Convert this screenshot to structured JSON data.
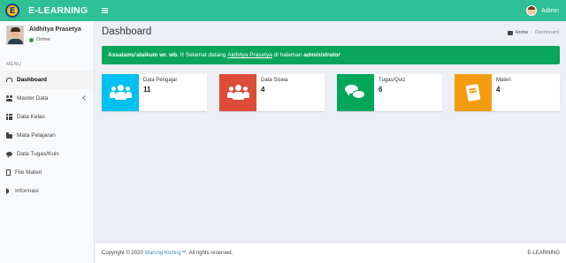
{
  "header": {
    "logo_letter": "E",
    "app_name": "E-LEARNING",
    "user_name": "Admin",
    "accent_color": "#2fc096"
  },
  "sidebar": {
    "user": {
      "name": "Aldhitya Prasetya",
      "status": "Online"
    },
    "menu_header": "MENU",
    "items": [
      {
        "label": "Dashboard",
        "icon": "dashboard-icon",
        "active": true
      },
      {
        "label": "Master Data",
        "icon": "users-icon",
        "has_submenu": true
      },
      {
        "label": "Data Kelas",
        "icon": "grid-icon"
      },
      {
        "label": "Mata Pelajaran",
        "icon": "folder-icon"
      },
      {
        "label": "Data Tugas/Kuis",
        "icon": "comments-icon"
      },
      {
        "label": "File Materi",
        "icon": "file-icon"
      },
      {
        "label": "Informasi",
        "icon": "bullhorn-icon"
      }
    ]
  },
  "content": {
    "title": "Dashboard",
    "breadcrumb": {
      "home": "Home",
      "current": "Dashboard"
    },
    "alert": {
      "greeting": "Assalamu'alaikum wr. wb. !!",
      "text1": " Selamat datang ",
      "user": "Aldhitya Prasetya",
      "text2": " di halaman ",
      "role": "administrator"
    },
    "info_boxes": [
      {
        "label": "Data Pengajar",
        "value": "11",
        "color": "#00c0ef",
        "icon": "users-icon"
      },
      {
        "label": "Data Siswa",
        "value": "4",
        "color": "#dd4b39",
        "icon": "users-icon"
      },
      {
        "label": "Tugas/Quiz",
        "value": "6",
        "color": "#00a65a",
        "icon": "comments-icon"
      },
      {
        "label": "Materi",
        "value": "4",
        "color": "#f39c12",
        "icon": "book-icon"
      }
    ]
  },
  "footer": {
    "prefix": "Copyright © 2020 ",
    "link": "Warung Koding™",
    "suffix": ". All rights reserved.",
    "right": "E-LEARNING"
  }
}
